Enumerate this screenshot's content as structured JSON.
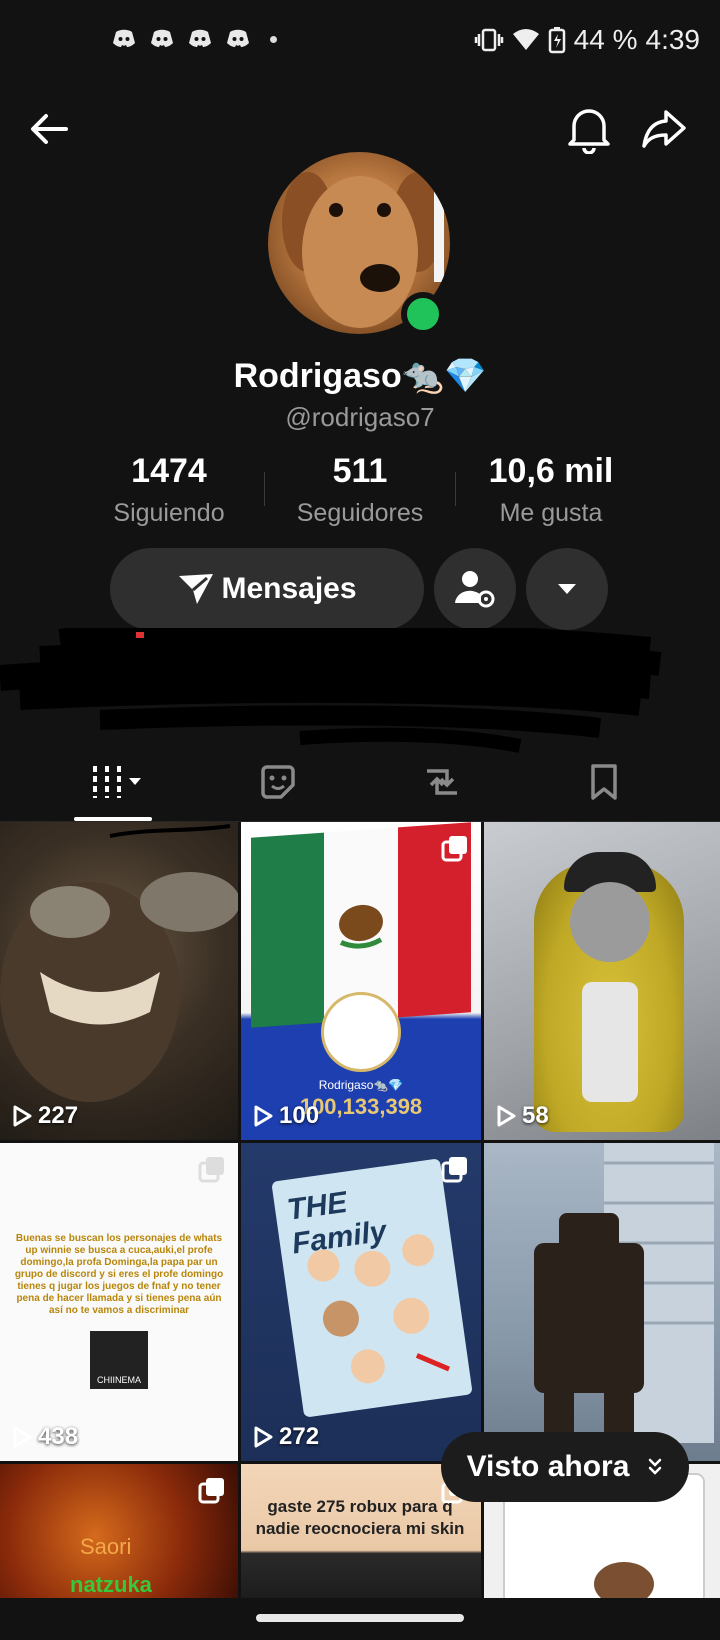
{
  "status_bar": {
    "battery_percent": "44 %",
    "time": "4:39",
    "notification_icons": [
      "discord-icon",
      "discord-icon",
      "discord-icon",
      "discord-icon"
    ]
  },
  "profile": {
    "display_name": "Rodrigaso🐀💎",
    "username": "@rodrigaso7",
    "online_color": "#20c35a",
    "stats": [
      {
        "value": "1474",
        "label": "Siguiendo"
      },
      {
        "value": "511",
        "label": "Seguidores"
      },
      {
        "value": "10,6 mil",
        "label": "Me gusta"
      }
    ]
  },
  "actions": {
    "messages_label": "Mensajes"
  },
  "tabs": [
    {
      "name": "videos-grid",
      "icon": "grid-icon",
      "active": true
    },
    {
      "name": "stickers",
      "icon": "sticker-icon"
    },
    {
      "name": "reposts",
      "icon": "repost-icon"
    },
    {
      "name": "saved",
      "icon": "bookmark-icon"
    }
  ],
  "videos": [
    {
      "views": "227"
    },
    {
      "views": "100",
      "overlay_name": "Rodrigaso🐀💎",
      "overlay_count": "100,133,398"
    },
    {
      "views": "58"
    },
    {
      "views": "438",
      "text": "Buenas se buscan los personajes de whats up winnie se busca a cuca,auki,el profe domingo,la profa Dominga,la papa par un grupo de discord y si eres el profe domingo tienes q jugar los juegos de fnaf y no tener pena de hacer llamada y si tienes pena aún así no te vamos a discriminar",
      "logo_text": "CHIINEMA"
    },
    {
      "views": "272",
      "title": "THE Family"
    },
    {
      "views": ""
    },
    {
      "views": "",
      "text_top": "Saori",
      "text_bottom": "natzuka"
    },
    {
      "views": "",
      "text": "gaste 275 robux para q nadie reocnociera mi skin"
    },
    {
      "views": ""
    }
  ],
  "visto_ahora": {
    "label": "Visto ahora"
  }
}
